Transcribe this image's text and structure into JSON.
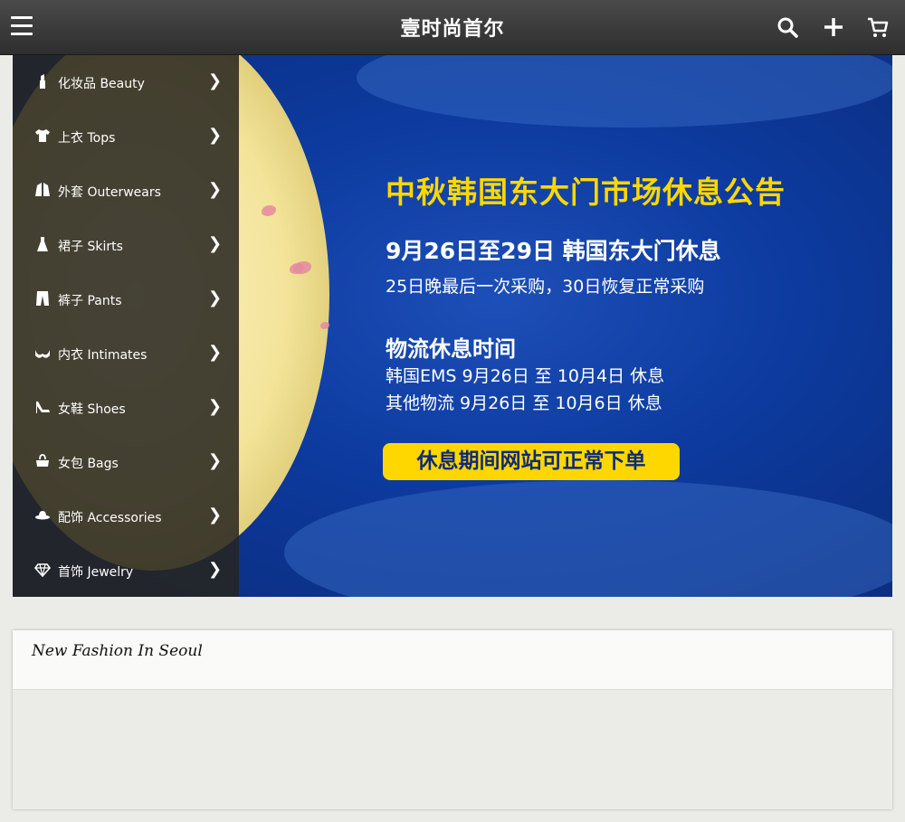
{
  "header": {
    "brand": "壹时尚首尔",
    "icons": [
      "menu-icon",
      "search-icon",
      "plus-icon",
      "cart-icon"
    ]
  },
  "sidebar": {
    "items": [
      {
        "label": "化妆品 Beauty",
        "icon": "lipstick-icon"
      },
      {
        "label": "上衣 Tops",
        "icon": "tshirt-icon"
      },
      {
        "label": "外套 Outerwears",
        "icon": "jacket-icon"
      },
      {
        "label": "裙子 Skirts",
        "icon": "dress-icon"
      },
      {
        "label": "裤子 Pants",
        "icon": "pants-icon"
      },
      {
        "label": "内衣 Intimates",
        "icon": "bra-icon"
      },
      {
        "label": "女鞋 Shoes",
        "icon": "heel-icon"
      },
      {
        "label": "女包 Bags",
        "icon": "bag-icon"
      },
      {
        "label": "配饰 Accessories",
        "icon": "hat-icon"
      },
      {
        "label": "首饰 Jewelry",
        "icon": "diamond-icon"
      }
    ]
  },
  "banner": {
    "title": "中秋韩国东大门市场休息公告",
    "closed": "9月26日至29日 韩国东大门休息",
    "resume": "25日晚最后一次采购，30日恢复正常采购",
    "logistics_title": "物流休息时间",
    "ems": "韩国EMS 9月26日 至 10月4日 休息",
    "other": "其他物流  9月26日 至 10月6日 休息",
    "order_note": "休息期间网站可正常下单"
  },
  "section": {
    "title": "New Fashion In Seoul"
  },
  "colors": {
    "topbar": "#3a3a3a",
    "banner_blue": "#0c3a9e",
    "banner_yellow": "#ffd700",
    "sidebar": "#26241e"
  }
}
